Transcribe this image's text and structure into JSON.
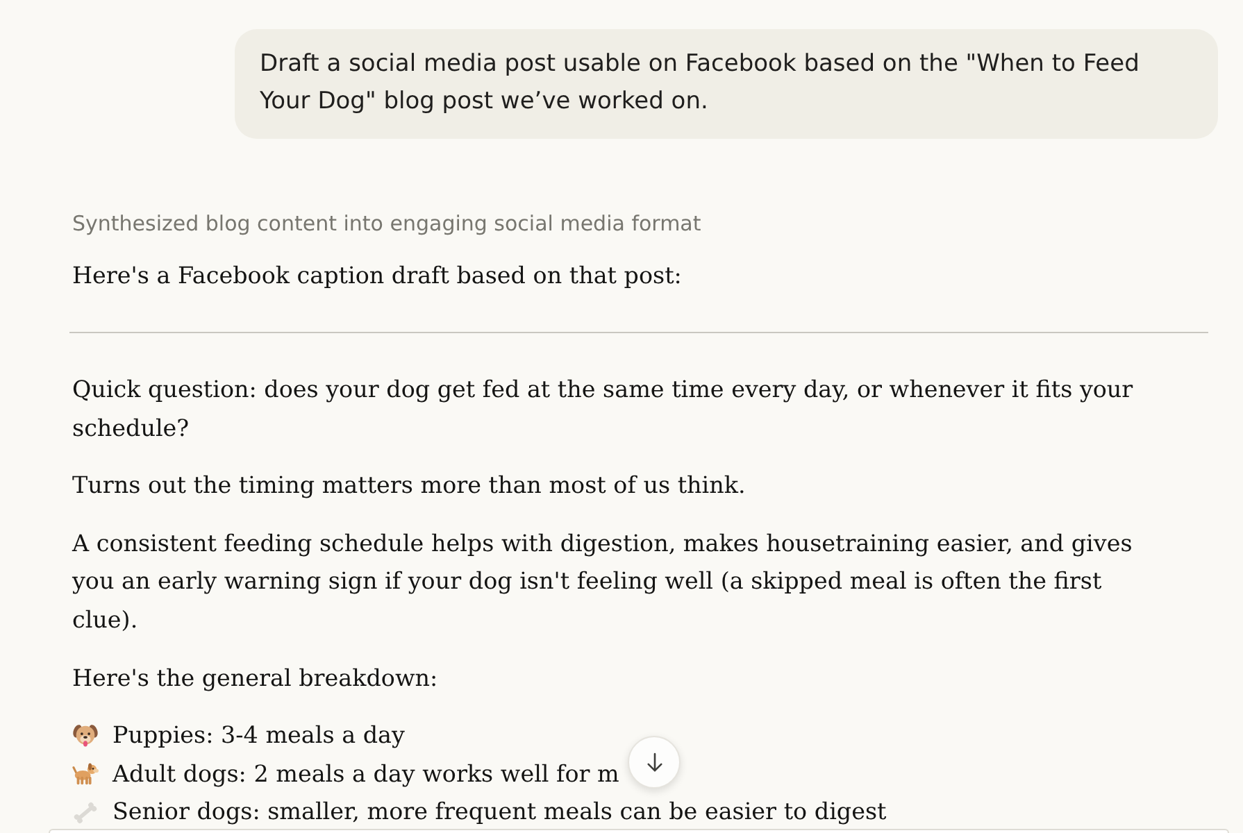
{
  "user_message": {
    "text": "Draft a social media post usable on Facebook based on the \"When to Feed Your Dog\" blog post we’ve worked on."
  },
  "response": {
    "thinking_summary": "Synthesized blog content into engaging social media format",
    "intro": "Here's a Facebook caption draft based on that post:",
    "post": {
      "paragraphs": [
        "Quick question: does your dog get fed at the same time every day, or whenever it fits your schedule?",
        "Turns out the timing matters more than most of us think.",
        "A consistent feeding schedule helps with digestion, makes housetraining easier, and gives you an early warning sign if your dog isn't feeling well (a skipped meal is often the first clue).",
        "Here's the general breakdown:"
      ],
      "list": [
        {
          "text": "Puppies: 3-4 meals a day"
        },
        {
          "text": "Adult dogs: 2 meals a day works well for m"
        },
        {
          "text": "Senior dogs: smaller, more frequent meals can be easier to digest"
        }
      ]
    }
  }
}
